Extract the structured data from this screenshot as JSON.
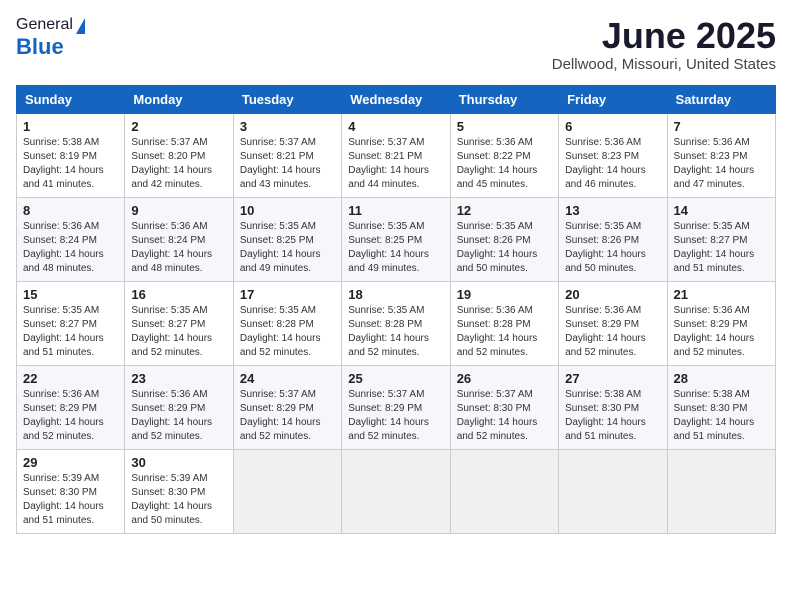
{
  "header": {
    "logo_general": "General",
    "logo_blue": "Blue",
    "title": "June 2025",
    "subtitle": "Dellwood, Missouri, United States"
  },
  "calendar": {
    "days_of_week": [
      "Sunday",
      "Monday",
      "Tuesday",
      "Wednesday",
      "Thursday",
      "Friday",
      "Saturday"
    ],
    "weeks": [
      [
        {
          "day": "1",
          "info": "Sunrise: 5:38 AM\nSunset: 8:19 PM\nDaylight: 14 hours\nand 41 minutes."
        },
        {
          "day": "2",
          "info": "Sunrise: 5:37 AM\nSunset: 8:20 PM\nDaylight: 14 hours\nand 42 minutes."
        },
        {
          "day": "3",
          "info": "Sunrise: 5:37 AM\nSunset: 8:21 PM\nDaylight: 14 hours\nand 43 minutes."
        },
        {
          "day": "4",
          "info": "Sunrise: 5:37 AM\nSunset: 8:21 PM\nDaylight: 14 hours\nand 44 minutes."
        },
        {
          "day": "5",
          "info": "Sunrise: 5:36 AM\nSunset: 8:22 PM\nDaylight: 14 hours\nand 45 minutes."
        },
        {
          "day": "6",
          "info": "Sunrise: 5:36 AM\nSunset: 8:23 PM\nDaylight: 14 hours\nand 46 minutes."
        },
        {
          "day": "7",
          "info": "Sunrise: 5:36 AM\nSunset: 8:23 PM\nDaylight: 14 hours\nand 47 minutes."
        }
      ],
      [
        {
          "day": "8",
          "info": "Sunrise: 5:36 AM\nSunset: 8:24 PM\nDaylight: 14 hours\nand 48 minutes."
        },
        {
          "day": "9",
          "info": "Sunrise: 5:36 AM\nSunset: 8:24 PM\nDaylight: 14 hours\nand 48 minutes."
        },
        {
          "day": "10",
          "info": "Sunrise: 5:35 AM\nSunset: 8:25 PM\nDaylight: 14 hours\nand 49 minutes."
        },
        {
          "day": "11",
          "info": "Sunrise: 5:35 AM\nSunset: 8:25 PM\nDaylight: 14 hours\nand 49 minutes."
        },
        {
          "day": "12",
          "info": "Sunrise: 5:35 AM\nSunset: 8:26 PM\nDaylight: 14 hours\nand 50 minutes."
        },
        {
          "day": "13",
          "info": "Sunrise: 5:35 AM\nSunset: 8:26 PM\nDaylight: 14 hours\nand 50 minutes."
        },
        {
          "day": "14",
          "info": "Sunrise: 5:35 AM\nSunset: 8:27 PM\nDaylight: 14 hours\nand 51 minutes."
        }
      ],
      [
        {
          "day": "15",
          "info": "Sunrise: 5:35 AM\nSunset: 8:27 PM\nDaylight: 14 hours\nand 51 minutes."
        },
        {
          "day": "16",
          "info": "Sunrise: 5:35 AM\nSunset: 8:27 PM\nDaylight: 14 hours\nand 52 minutes."
        },
        {
          "day": "17",
          "info": "Sunrise: 5:35 AM\nSunset: 8:28 PM\nDaylight: 14 hours\nand 52 minutes."
        },
        {
          "day": "18",
          "info": "Sunrise: 5:35 AM\nSunset: 8:28 PM\nDaylight: 14 hours\nand 52 minutes."
        },
        {
          "day": "19",
          "info": "Sunrise: 5:36 AM\nSunset: 8:28 PM\nDaylight: 14 hours\nand 52 minutes."
        },
        {
          "day": "20",
          "info": "Sunrise: 5:36 AM\nSunset: 8:29 PM\nDaylight: 14 hours\nand 52 minutes."
        },
        {
          "day": "21",
          "info": "Sunrise: 5:36 AM\nSunset: 8:29 PM\nDaylight: 14 hours\nand 52 minutes."
        }
      ],
      [
        {
          "day": "22",
          "info": "Sunrise: 5:36 AM\nSunset: 8:29 PM\nDaylight: 14 hours\nand 52 minutes."
        },
        {
          "day": "23",
          "info": "Sunrise: 5:36 AM\nSunset: 8:29 PM\nDaylight: 14 hours\nand 52 minutes."
        },
        {
          "day": "24",
          "info": "Sunrise: 5:37 AM\nSunset: 8:29 PM\nDaylight: 14 hours\nand 52 minutes."
        },
        {
          "day": "25",
          "info": "Sunrise: 5:37 AM\nSunset: 8:29 PM\nDaylight: 14 hours\nand 52 minutes."
        },
        {
          "day": "26",
          "info": "Sunrise: 5:37 AM\nSunset: 8:30 PM\nDaylight: 14 hours\nand 52 minutes."
        },
        {
          "day": "27",
          "info": "Sunrise: 5:38 AM\nSunset: 8:30 PM\nDaylight: 14 hours\nand 51 minutes."
        },
        {
          "day": "28",
          "info": "Sunrise: 5:38 AM\nSunset: 8:30 PM\nDaylight: 14 hours\nand 51 minutes."
        }
      ],
      [
        {
          "day": "29",
          "info": "Sunrise: 5:39 AM\nSunset: 8:30 PM\nDaylight: 14 hours\nand 51 minutes."
        },
        {
          "day": "30",
          "info": "Sunrise: 5:39 AM\nSunset: 8:30 PM\nDaylight: 14 hours\nand 50 minutes."
        },
        {
          "day": "",
          "info": ""
        },
        {
          "day": "",
          "info": ""
        },
        {
          "day": "",
          "info": ""
        },
        {
          "day": "",
          "info": ""
        },
        {
          "day": "",
          "info": ""
        }
      ]
    ]
  }
}
